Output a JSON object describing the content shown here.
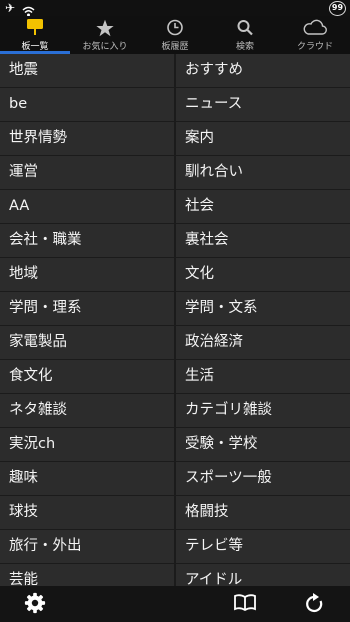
{
  "status_bar": {
    "battery_text": "99"
  },
  "tabs": [
    {
      "label": "板一覧",
      "icon": "board-list-icon",
      "active": true
    },
    {
      "label": "お気に入り",
      "icon": "star-icon",
      "active": false
    },
    {
      "label": "板履歴",
      "icon": "clock-icon",
      "active": false
    },
    {
      "label": "検索",
      "icon": "search-icon",
      "active": false
    },
    {
      "label": "クラウド",
      "icon": "cloud-icon",
      "active": false
    }
  ],
  "categories": [
    "地震",
    "おすすめ",
    "be",
    "ニュース",
    "世界情勢",
    "案内",
    "運営",
    "馴れ合い",
    "AA",
    "社会",
    "会社・職業",
    "裏社会",
    "地域",
    "文化",
    "学問・理系",
    "学問・文系",
    "家電製品",
    "政治経済",
    "食文化",
    "生活",
    "ネタ雑談",
    "カテゴリ雑談",
    "実況ch",
    "受験・学校",
    "趣味",
    "スポーツ一般",
    "球技",
    "格闘技",
    "旅行・外出",
    "テレビ等",
    "芸能",
    "アイドル"
  ],
  "toolbar": {
    "icons": [
      "gear-icon",
      "book-icon",
      "refresh-icon"
    ]
  },
  "colors": {
    "accent": "#2a6fd6",
    "tab_icon_active": "#f2c200",
    "cell_bg": "#2c2c2c",
    "grid_line": "#1b1b1b"
  }
}
